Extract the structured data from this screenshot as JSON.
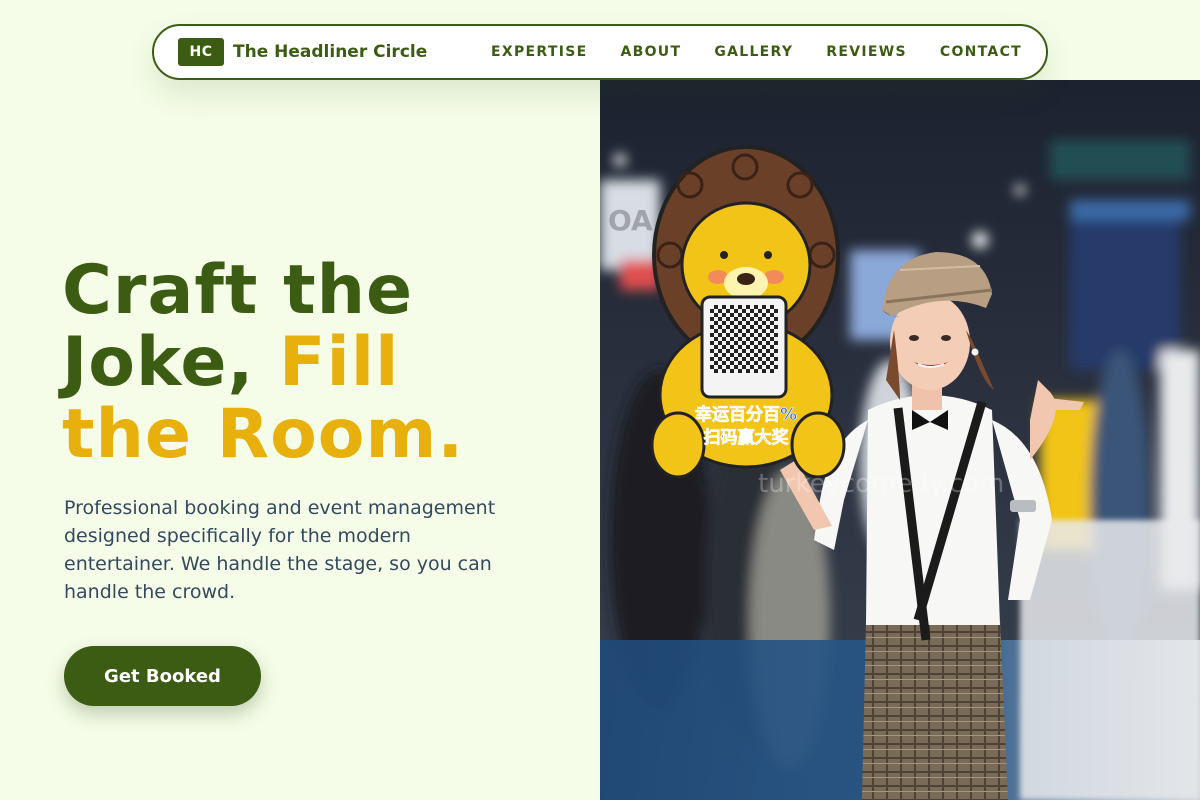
{
  "brand": {
    "badge": "HC",
    "name": "The Headliner Circle"
  },
  "nav": {
    "links": [
      "EXPERTISE",
      "ABOUT",
      "GALLERY",
      "REVIEWS",
      "CONTACT"
    ]
  },
  "hero": {
    "headline_line1": "Craft the",
    "headline_line2_a": "Joke, ",
    "headline_line2_b": "Fill",
    "headline_line3": "the Room.",
    "subtext": "Professional booking and event management designed specifically for the modern entertainer. We handle the stage, so you can handle the crowd.",
    "cta_label": "Get Booked"
  },
  "photo": {
    "sign_text_line1": "幸运百分百%",
    "sign_text_line2": "扫码赢大奖",
    "watermark": "turkeycomedy.com",
    "booth_sign": "OA"
  },
  "colors": {
    "primary": "#3b5c12",
    "accent": "#e8b00c",
    "background": "#f5fde8",
    "body_text": "#34495e"
  }
}
